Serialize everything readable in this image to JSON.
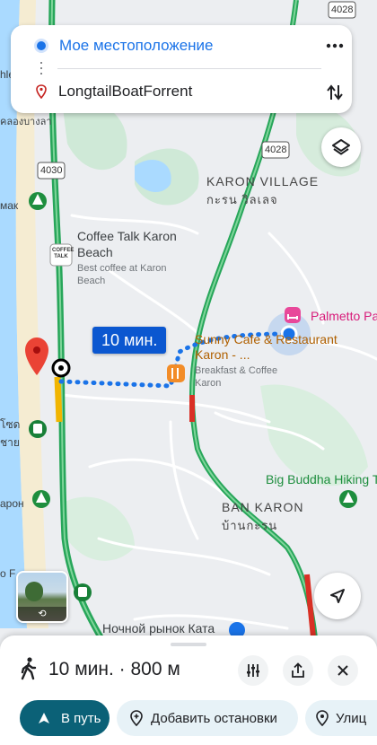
{
  "route_card": {
    "origin": "Мое местоположение",
    "destination": "LongtailBoatForrent"
  },
  "map_labels": {
    "road_4028": "4028",
    "road_4030": "4030",
    "karon_village": "KARON VILLAGE",
    "karon_village_thai": "กะรน วิลเลจ",
    "coffee_talk_name": "Coffee Talk Karon Beach",
    "coffee_talk_desc": "Best coffee at Karon Beach",
    "coffee_talk_logo": "COFFEE TALK",
    "palmetto": "Palmetto Pa",
    "sunny_cafe_name": "Sunny Cafe & Restaurant Karon - ...",
    "sunny_cafe_desc": "Breakfast & Coffee Karon",
    "big_buddha": "Big Buddha Hiking T",
    "ban_karon": "BAN KARON",
    "ban_karon_thai": "บ้านกะรน",
    "night_market": "Ночной рынок Ката",
    "left_edge_1": "hle",
    "left_edge_2": "คลองบางลา",
    "left_edge_3": "мак",
    "left_edge_4": "โซด",
    "left_edge_5": "ชาย",
    "left_edge_6": "арон",
    "left_edge_7": "o F"
  },
  "route_badge": "10 мин.",
  "summary": {
    "time_distance": "10 мин. · 800 м"
  },
  "actions": {
    "go": "В путь",
    "add_stops": "Добавить остановки",
    "places": "Улиц"
  },
  "colors": {
    "accent": "#1a73e8",
    "go_button": "#0b6177",
    "road_green": "#27a65a",
    "water": "#aadaff",
    "map_bg": "#eceef1"
  }
}
